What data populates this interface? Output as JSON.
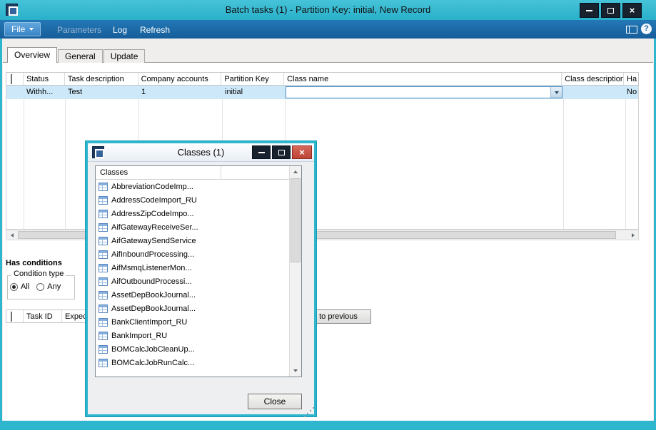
{
  "titlebar": {
    "title": "Batch tasks (1) - Partition Key: initial, New Record"
  },
  "menubar": {
    "file_label": "File",
    "items": [
      {
        "label": "Parameters",
        "enabled": false
      },
      {
        "label": "Log",
        "enabled": true
      },
      {
        "label": "Refresh",
        "enabled": true
      }
    ]
  },
  "tabs": [
    {
      "label": "Overview",
      "active": true
    },
    {
      "label": "General",
      "active": false
    },
    {
      "label": "Update",
      "active": false
    }
  ],
  "tasks_grid": {
    "columns": [
      "Status",
      "Task description",
      "Company accounts",
      "Partition Key",
      "Class name",
      "Class description",
      "Ha"
    ],
    "row": {
      "status": "Withh...",
      "task_description": "Test",
      "company_accounts": "1",
      "partition_key": "initial",
      "class_name": "",
      "class_description": "",
      "has_conditions": "No"
    }
  },
  "conditions": {
    "heading": "Has conditions",
    "group_label": "Condition type",
    "options": [
      {
        "label": "All",
        "selected": true
      },
      {
        "label": "Any",
        "selected": false
      }
    ]
  },
  "conditions_grid": {
    "columns": [
      "Task ID",
      "Expect"
    ]
  },
  "to_previous_button": "to previous",
  "classes_dialog": {
    "title": "Classes (1)",
    "list_header": "Classes",
    "items": [
      "AbbreviationCodeImp...",
      "AddressCodeImport_RU",
      "AddressZipCodeImpo...",
      "AifGatewayReceiveSer...",
      "AifGatewaySendService",
      "AifInboundProcessing...",
      "AifMsmqListenerMon...",
      "AifOutboundProcessi...",
      "AssetDepBookJournal...",
      "AssetDepBookJournal...",
      "BankClientImport_RU",
      "BankImport_RU",
      "BOMCalcJobCleanUp...",
      "BOMCalcJobRunCalc..."
    ],
    "close_button": "Close"
  },
  "colors": {
    "accent_teal": "#2eb6cf",
    "menubar_blue": "#1a66a5",
    "selection_blue": "#cde9f9",
    "close_red": "#c75050"
  }
}
